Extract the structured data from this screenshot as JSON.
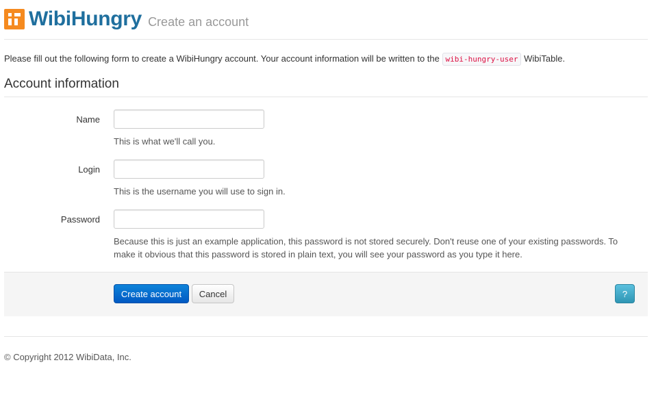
{
  "header": {
    "brand": "WibiHungry",
    "subtitle": "Create an account"
  },
  "intro": {
    "before": "Please fill out the following form to create a WibiHungry account. Your account information will be written to the",
    "code": "wibi-hungry-user",
    "after": "WibiTable."
  },
  "form": {
    "legend": "Account information",
    "fields": [
      {
        "label": "Name",
        "value": "",
        "help": "This is what we'll call you."
      },
      {
        "label": "Login",
        "value": "",
        "help": "This is the username you will use to sign in."
      },
      {
        "label": "Password",
        "value": "",
        "help": "Because this is just an example application, this password is not stored securely. Don't reuse one of your existing passwords. To make it obvious that this password is stored in plain text, you will see your password as you type it here."
      }
    ]
  },
  "actions": {
    "create_label": "Create account",
    "cancel_label": "Cancel",
    "help_label": "?"
  },
  "footer": {
    "copyright": "© Copyright 2012 WibiData, Inc."
  },
  "colors": {
    "brand": "#1f6f9e",
    "logo": "#f58a1f",
    "primary": "#0e83d9",
    "info": "#5bc0de"
  }
}
